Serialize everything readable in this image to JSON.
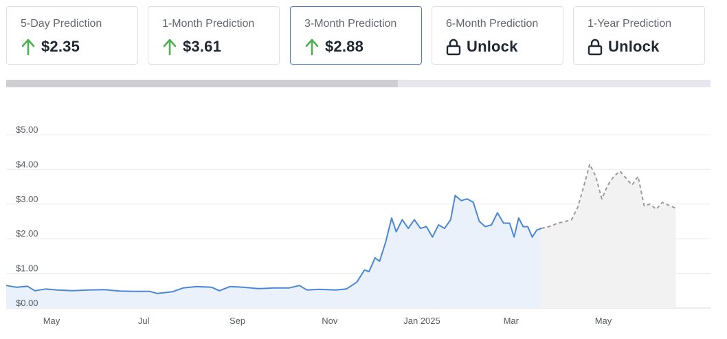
{
  "predictions": [
    {
      "label": "5-Day Prediction",
      "value": "$2.35",
      "icon": "arrow-up-icon",
      "active": false
    },
    {
      "label": "1-Month Prediction",
      "value": "$3.61",
      "icon": "arrow-up-icon",
      "active": false
    },
    {
      "label": "3-Month Prediction",
      "value": "$2.88",
      "icon": "arrow-up-icon",
      "active": true
    },
    {
      "label": "6-Month Prediction",
      "value": "Unlock",
      "icon": "lock-icon",
      "active": false
    },
    {
      "label": "1-Year Prediction",
      "value": "Unlock",
      "icon": "lock-icon",
      "active": false
    }
  ],
  "colors": {
    "up_arrow": "#4caf50",
    "historical_line": "#4a86d6",
    "historical_fill": "#eaf1fb",
    "forecast_line": "#9a9a9a",
    "forecast_fill": "#f2f2f2",
    "active_border": "#4a7fc1"
  },
  "chart_data": {
    "type": "line",
    "ylim": [
      0,
      5
    ],
    "y_ticks": [
      "$0.00",
      "$1.00",
      "$2.00",
      "$3.00",
      "$4.00",
      "$5.00"
    ],
    "x_ticks": [
      "May",
      "Jul",
      "Sep",
      "Nov",
      "Jan 2025",
      "Mar",
      "May"
    ],
    "grid": true,
    "series": [
      {
        "kind": "historical",
        "values": [
          {
            "x": "2024-04-01",
            "y": 0.65
          },
          {
            "x": "2024-04-08",
            "y": 0.6
          },
          {
            "x": "2024-04-15",
            "y": 0.63
          },
          {
            "x": "2024-04-20",
            "y": 0.5
          },
          {
            "x": "2024-04-27",
            "y": 0.55
          },
          {
            "x": "2024-05-05",
            "y": 0.52
          },
          {
            "x": "2024-05-15",
            "y": 0.5
          },
          {
            "x": "2024-05-25",
            "y": 0.52
          },
          {
            "x": "2024-06-05",
            "y": 0.53
          },
          {
            "x": "2024-06-15",
            "y": 0.49
          },
          {
            "x": "2024-06-25",
            "y": 0.48
          },
          {
            "x": "2024-07-05",
            "y": 0.48
          },
          {
            "x": "2024-07-10",
            "y": 0.42
          },
          {
            "x": "2024-07-20",
            "y": 0.47
          },
          {
            "x": "2024-07-27",
            "y": 0.58
          },
          {
            "x": "2024-08-05",
            "y": 0.62
          },
          {
            "x": "2024-08-15",
            "y": 0.6
          },
          {
            "x": "2024-08-20",
            "y": 0.5
          },
          {
            "x": "2024-08-27",
            "y": 0.62
          },
          {
            "x": "2024-09-05",
            "y": 0.6
          },
          {
            "x": "2024-09-15",
            "y": 0.56
          },
          {
            "x": "2024-09-25",
            "y": 0.58
          },
          {
            "x": "2024-10-05",
            "y": 0.58
          },
          {
            "x": "2024-10-12",
            "y": 0.65
          },
          {
            "x": "2024-10-17",
            "y": 0.52
          },
          {
            "x": "2024-10-25",
            "y": 0.54
          },
          {
            "x": "2024-11-05",
            "y": 0.52
          },
          {
            "x": "2024-11-12",
            "y": 0.55
          },
          {
            "x": "2024-11-19",
            "y": 0.75
          },
          {
            "x": "2024-11-24",
            "y": 1.1
          },
          {
            "x": "2024-11-27",
            "y": 1.05
          },
          {
            "x": "2024-12-01",
            "y": 1.45
          },
          {
            "x": "2024-12-04",
            "y": 1.35
          },
          {
            "x": "2024-12-08",
            "y": 1.9
          },
          {
            "x": "2024-12-12",
            "y": 2.6
          },
          {
            "x": "2024-12-15",
            "y": 2.2
          },
          {
            "x": "2024-12-19",
            "y": 2.55
          },
          {
            "x": "2024-12-23",
            "y": 2.3
          },
          {
            "x": "2024-12-27",
            "y": 2.55
          },
          {
            "x": "2024-12-31",
            "y": 2.3
          },
          {
            "x": "2025-01-04",
            "y": 2.35
          },
          {
            "x": "2025-01-08",
            "y": 2.05
          },
          {
            "x": "2025-01-12",
            "y": 2.4
          },
          {
            "x": "2025-01-16",
            "y": 2.3
          },
          {
            "x": "2025-01-20",
            "y": 2.55
          },
          {
            "x": "2025-01-23",
            "y": 3.25
          },
          {
            "x": "2025-01-27",
            "y": 3.1
          },
          {
            "x": "2025-01-31",
            "y": 3.15
          },
          {
            "x": "2025-02-04",
            "y": 3.05
          },
          {
            "x": "2025-02-08",
            "y": 2.5
          },
          {
            "x": "2025-02-12",
            "y": 2.35
          },
          {
            "x": "2025-02-16",
            "y": 2.4
          },
          {
            "x": "2025-02-20",
            "y": 2.75
          },
          {
            "x": "2025-02-24",
            "y": 2.45
          },
          {
            "x": "2025-02-28",
            "y": 2.45
          },
          {
            "x": "2025-03-03",
            "y": 2.05
          },
          {
            "x": "2025-03-06",
            "y": 2.6
          },
          {
            "x": "2025-03-09",
            "y": 2.35
          },
          {
            "x": "2025-03-12",
            "y": 2.35
          },
          {
            "x": "2025-03-15",
            "y": 2.05
          },
          {
            "x": "2025-03-18",
            "y": 2.25
          },
          {
            "x": "2025-03-21",
            "y": 2.3
          }
        ]
      },
      {
        "kind": "forecast",
        "values": [
          {
            "x": "2025-03-21",
            "y": 2.3
          },
          {
            "x": "2025-03-26",
            "y": 2.35
          },
          {
            "x": "2025-04-01",
            "y": 2.45
          },
          {
            "x": "2025-04-06",
            "y": 2.5
          },
          {
            "x": "2025-04-10",
            "y": 2.55
          },
          {
            "x": "2025-04-14",
            "y": 2.9
          },
          {
            "x": "2025-04-18",
            "y": 3.5
          },
          {
            "x": "2025-04-22",
            "y": 4.15
          },
          {
            "x": "2025-04-26",
            "y": 3.8
          },
          {
            "x": "2025-04-30",
            "y": 3.15
          },
          {
            "x": "2025-05-04",
            "y": 3.55
          },
          {
            "x": "2025-05-08",
            "y": 3.8
          },
          {
            "x": "2025-05-12",
            "y": 3.95
          },
          {
            "x": "2025-05-16",
            "y": 3.75
          },
          {
            "x": "2025-05-20",
            "y": 3.55
          },
          {
            "x": "2025-05-24",
            "y": 3.8
          },
          {
            "x": "2025-05-28",
            "y": 2.95
          },
          {
            "x": "2025-06-01",
            "y": 3.0
          },
          {
            "x": "2025-06-05",
            "y": 2.85
          },
          {
            "x": "2025-06-09",
            "y": 3.05
          },
          {
            "x": "2025-06-14",
            "y": 2.95
          },
          {
            "x": "2025-06-18",
            "y": 2.88
          }
        ]
      }
    ]
  }
}
